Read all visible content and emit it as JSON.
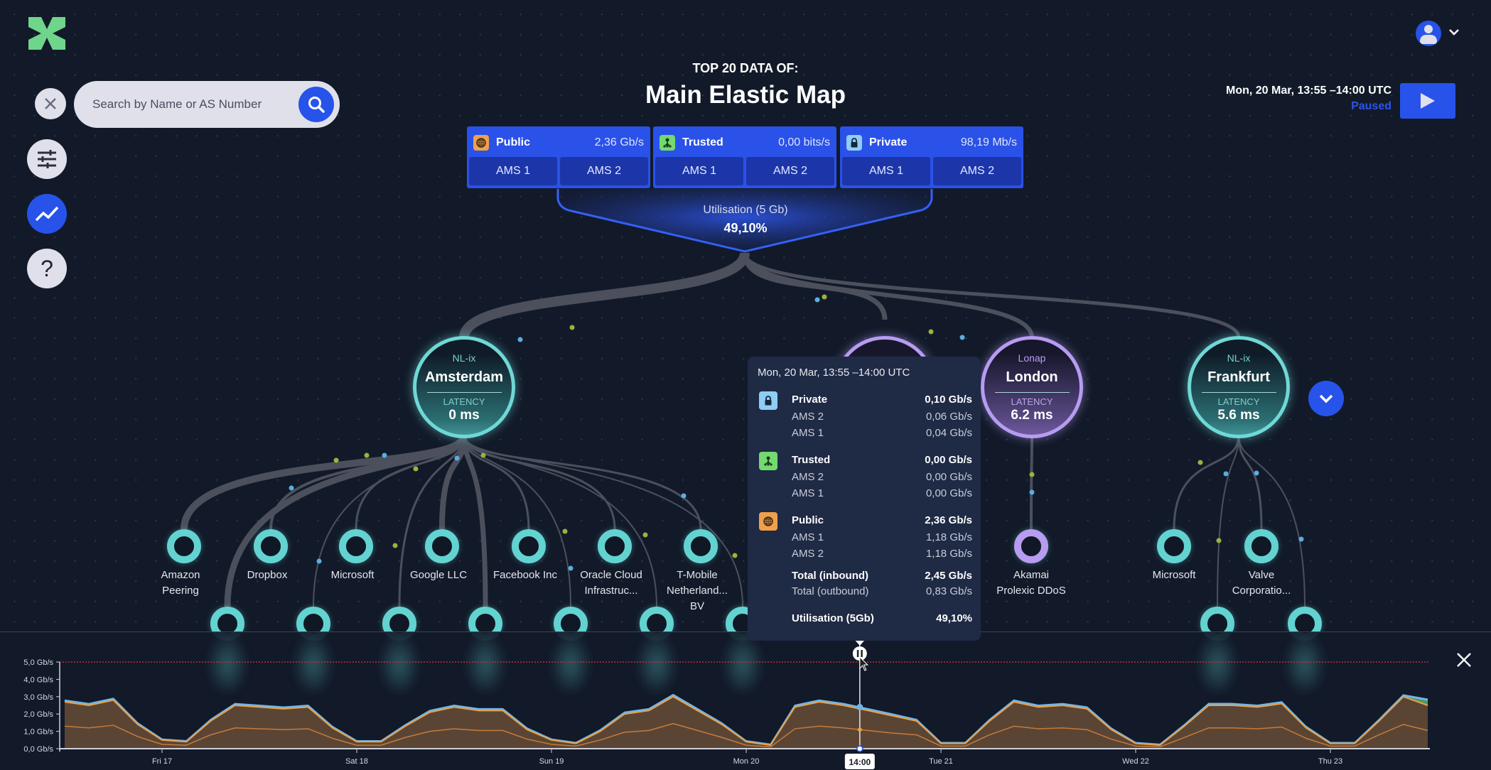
{
  "header": {
    "title_top": "TOP 20 DATA OF:",
    "title_main": "Main Elastic Map",
    "logo": "green-x-logo",
    "user_menu": "user-avatar-icon"
  },
  "search": {
    "placeholder": "Search by Name or AS Number",
    "value": ""
  },
  "sidebar": {
    "items": [
      {
        "name": "close",
        "icon": "close-icon"
      },
      {
        "name": "filters",
        "icon": "sliders-icon"
      },
      {
        "name": "chart",
        "icon": "trend-chart-icon",
        "active": true
      },
      {
        "name": "help",
        "icon": "question-icon",
        "label": "?"
      }
    ]
  },
  "playback": {
    "timestamp": "Mon, 20 Mar, 13:55 –14:00 UTC",
    "status": "Paused",
    "button": "play-icon"
  },
  "categories": [
    {
      "label": "Public",
      "value": "2,36 Gb/s",
      "icon": "globe-icon",
      "color": "#f0a04a",
      "subs": [
        "AMS 1",
        "AMS 2"
      ]
    },
    {
      "label": "Trusted",
      "value": "0,00 bits/s",
      "icon": "network-tree-icon",
      "color": "#74d96f",
      "subs": [
        "AMS 1",
        "AMS 2"
      ]
    },
    {
      "label": "Private",
      "value": "98,19 Mb/s",
      "icon": "lock-icon",
      "color": "#8fcdf5",
      "subs": [
        "AMS 1",
        "AMS 2"
      ]
    }
  ],
  "utilisation": {
    "label": "Utilisation (5 Gb)",
    "value": "49,10%"
  },
  "hubs": [
    {
      "ix": "NL-ix",
      "name": "Amsterdam",
      "latency_label": "LATENCY",
      "latency": "0 ms",
      "color": "#6fd8d6"
    },
    {
      "ix": "Lonap",
      "name": "London",
      "latency_label": "LATENCY",
      "latency": "6.2 ms",
      "color": "#b79cf2"
    },
    {
      "ix": "NL-ix",
      "name": "Frankfurt",
      "latency_label": "LATENCY",
      "latency": "5.6 ms",
      "color": "#6fd8d6"
    }
  ],
  "leaves": [
    {
      "name": "Amazon Peering"
    },
    {
      "name": "Dropbox"
    },
    {
      "name": "Microsoft"
    },
    {
      "name": "Google LLC"
    },
    {
      "name": "Facebook Inc"
    },
    {
      "name": "Oracle Cloud Infrastruc..."
    },
    {
      "name": "T-Mobile Netherland... BV"
    },
    {
      "name": "Akamai Prolexic DDoS"
    },
    {
      "name": "Microsoft"
    },
    {
      "name": "Valve Corporatio..."
    }
  ],
  "tooltip": {
    "title": "Mon, 20 Mar, 13:55 –14:00 UTC",
    "groups": [
      {
        "label": "Private",
        "value": "0,10 Gb/s",
        "icon": "lock-icon",
        "color": "#8fcdf5",
        "rows": [
          {
            "label": "AMS 2",
            "value": "0,06 Gb/s"
          },
          {
            "label": "AMS 1",
            "value": "0,04 Gb/s"
          }
        ]
      },
      {
        "label": "Trusted",
        "value": "0,00 Gb/s",
        "icon": "network-tree-icon",
        "color": "#74d96f",
        "rows": [
          {
            "label": "AMS 2",
            "value": "0,00 Gb/s"
          },
          {
            "label": "AMS 1",
            "value": "0,00 Gb/s"
          }
        ]
      },
      {
        "label": "Public",
        "value": "2,36 Gb/s",
        "icon": "globe-icon",
        "color": "#f0a04a",
        "rows": [
          {
            "label": "AMS 1",
            "value": "1,18 Gb/s"
          },
          {
            "label": "AMS 2",
            "value": "1,18 Gb/s"
          }
        ]
      }
    ],
    "total_in": {
      "label": "Total (inbound)",
      "value": "2,45 Gb/s"
    },
    "total_out": {
      "label": "Total (outbound)",
      "value": "0,83 Gb/s"
    },
    "util": {
      "label": "Utilisation (5Gb)",
      "value": "49,10%"
    }
  },
  "chart_data": {
    "type": "area",
    "stacked": true,
    "x": [
      "Thu 16 12:00",
      "Thu 16 15:00",
      "Thu 16 18:00",
      "Thu 16 21:00",
      "Fri 17 00:00",
      "Fri 17 03:00",
      "Fri 17 06:00",
      "Fri 17 09:00",
      "Fri 17 12:00",
      "Fri 17 15:00",
      "Fri 17 18:00",
      "Fri 17 21:00",
      "Sat 18 00:00",
      "Sat 18 03:00",
      "Sat 18 06:00",
      "Sat 18 09:00",
      "Sat 18 12:00",
      "Sat 18 15:00",
      "Sat 18 18:00",
      "Sat 18 21:00",
      "Sun 19 00:00",
      "Sun 19 03:00",
      "Sun 19 06:00",
      "Sun 19 09:00",
      "Sun 19 12:00",
      "Sun 19 15:00",
      "Sun 19 18:00",
      "Sun 19 21:00",
      "Mon 20 00:00",
      "Mon 20 03:00",
      "Mon 20 06:00",
      "Mon 20 09:00",
      "Mon 20 12:00",
      "Mon 20 15:00",
      "Mon 20 18:00",
      "Mon 20 21:00",
      "Tue 21 00:00",
      "Tue 21 03:00",
      "Tue 21 06:00",
      "Tue 21 09:00",
      "Tue 21 12:00",
      "Tue 21 15:00",
      "Tue 21 18:00",
      "Tue 21 21:00",
      "Wed 22 00:00",
      "Wed 22 03:00",
      "Wed 22 06:00",
      "Wed 22 09:00",
      "Wed 22 12:00",
      "Wed 22 15:00",
      "Wed 22 18:00",
      "Wed 22 21:00",
      "Thu 23 00:00",
      "Thu 23 03:00",
      "Thu 23 06:00",
      "Thu 23 09:00",
      "Thu 23 12:00"
    ],
    "series": [
      {
        "name": "Public",
        "color": "#e8a04a",
        "values": [
          2.7,
          2.5,
          2.8,
          1.4,
          0.5,
          0.4,
          1.6,
          2.5,
          2.4,
          2.3,
          2.4,
          1.2,
          0.4,
          0.4,
          1.3,
          2.1,
          2.4,
          2.2,
          2.2,
          1.1,
          0.5,
          0.3,
          1.0,
          2.0,
          2.2,
          3.0,
          2.2,
          1.4,
          0.4,
          0.2,
          2.4,
          2.7,
          2.5,
          2.2,
          1.9,
          1.6,
          0.3,
          0.3,
          1.6,
          2.7,
          2.4,
          2.5,
          2.3,
          1.1,
          0.3,
          0.2,
          1.3,
          2.5,
          2.5,
          2.4,
          2.6,
          1.2,
          0.3,
          0.3,
          1.6,
          3.0,
          2.5
        ]
      },
      {
        "name": "Trusted",
        "color": "#4f9a55",
        "values": [
          0,
          0,
          0,
          0,
          0,
          0,
          0,
          0,
          0,
          0,
          0,
          0,
          0,
          0,
          0,
          0,
          0,
          0,
          0,
          0,
          0,
          0,
          0,
          0,
          0,
          0,
          0,
          0,
          0,
          0,
          0,
          0,
          0,
          0,
          0,
          0,
          0,
          0,
          0,
          0,
          0,
          0,
          0,
          0,
          0,
          0,
          0,
          0,
          0,
          0,
          0,
          0,
          0,
          0,
          0,
          0,
          0.25
        ]
      },
      {
        "name": "Private",
        "color": "#6fb6e8",
        "values": [
          0.1,
          0.1,
          0.1,
          0.08,
          0.05,
          0.05,
          0.08,
          0.1,
          0.1,
          0.1,
          0.1,
          0.08,
          0.05,
          0.05,
          0.08,
          0.1,
          0.1,
          0.1,
          0.1,
          0.08,
          0.05,
          0.05,
          0.08,
          0.1,
          0.1,
          0.12,
          0.1,
          0.08,
          0.05,
          0.05,
          0.1,
          0.1,
          0.1,
          0.1,
          0.1,
          0.08,
          0.05,
          0.05,
          0.08,
          0.1,
          0.1,
          0.1,
          0.1,
          0.08,
          0.05,
          0.05,
          0.08,
          0.1,
          0.1,
          0.1,
          0.1,
          0.08,
          0.05,
          0.05,
          0.08,
          0.1,
          0.1
        ]
      },
      {
        "name": "Total (outbound)",
        "color": "#c77a3a",
        "line_only": true,
        "values": [
          1.3,
          1.2,
          1.35,
          0.7,
          0.25,
          0.2,
          0.8,
          1.2,
          1.15,
          1.1,
          1.15,
          0.6,
          0.2,
          0.2,
          0.65,
          1.0,
          1.15,
          1.05,
          1.05,
          0.55,
          0.25,
          0.15,
          0.5,
          0.95,
          1.05,
          1.45,
          1.05,
          0.65,
          0.2,
          0.1,
          1.15,
          1.3,
          1.2,
          1.05,
          0.9,
          0.8,
          0.15,
          0.15,
          0.8,
          1.3,
          1.15,
          1.2,
          1.1,
          0.55,
          0.15,
          0.1,
          0.65,
          1.2,
          1.2,
          1.15,
          1.25,
          0.6,
          0.15,
          0.15,
          0.8,
          1.4,
          1.05
        ]
      }
    ],
    "ylim": [
      0,
      5
    ],
    "y_ticks": [
      "0,0 Gb/s",
      "1,0 Gb/s",
      "2,0 Gb/s",
      "3,0 Gb/s",
      "4,0 Gb/s",
      "5,0 Gb/s"
    ],
    "x_ticks": [
      {
        "label": "Fri 17",
        "at": "Fri 17 00:00"
      },
      {
        "label": "Sat 18",
        "at": "Sat 18 00:00"
      },
      {
        "label": "Sun 19",
        "at": "Sun 19 00:00"
      },
      {
        "label": "Mon 20",
        "at": "Mon 20 00:00"
      },
      {
        "label": "Tue 21",
        "at": "Tue 21 00:00"
      },
      {
        "label": "Wed 22",
        "at": "Wed 22 00:00"
      },
      {
        "label": "Thu 23",
        "at": "Thu 23 00:00"
      }
    ],
    "threshold": {
      "value": 5.0,
      "color": "#b8303a"
    },
    "cursor": {
      "at": "Mon 20 14:00",
      "label": "14:00"
    },
    "grid": false
  }
}
